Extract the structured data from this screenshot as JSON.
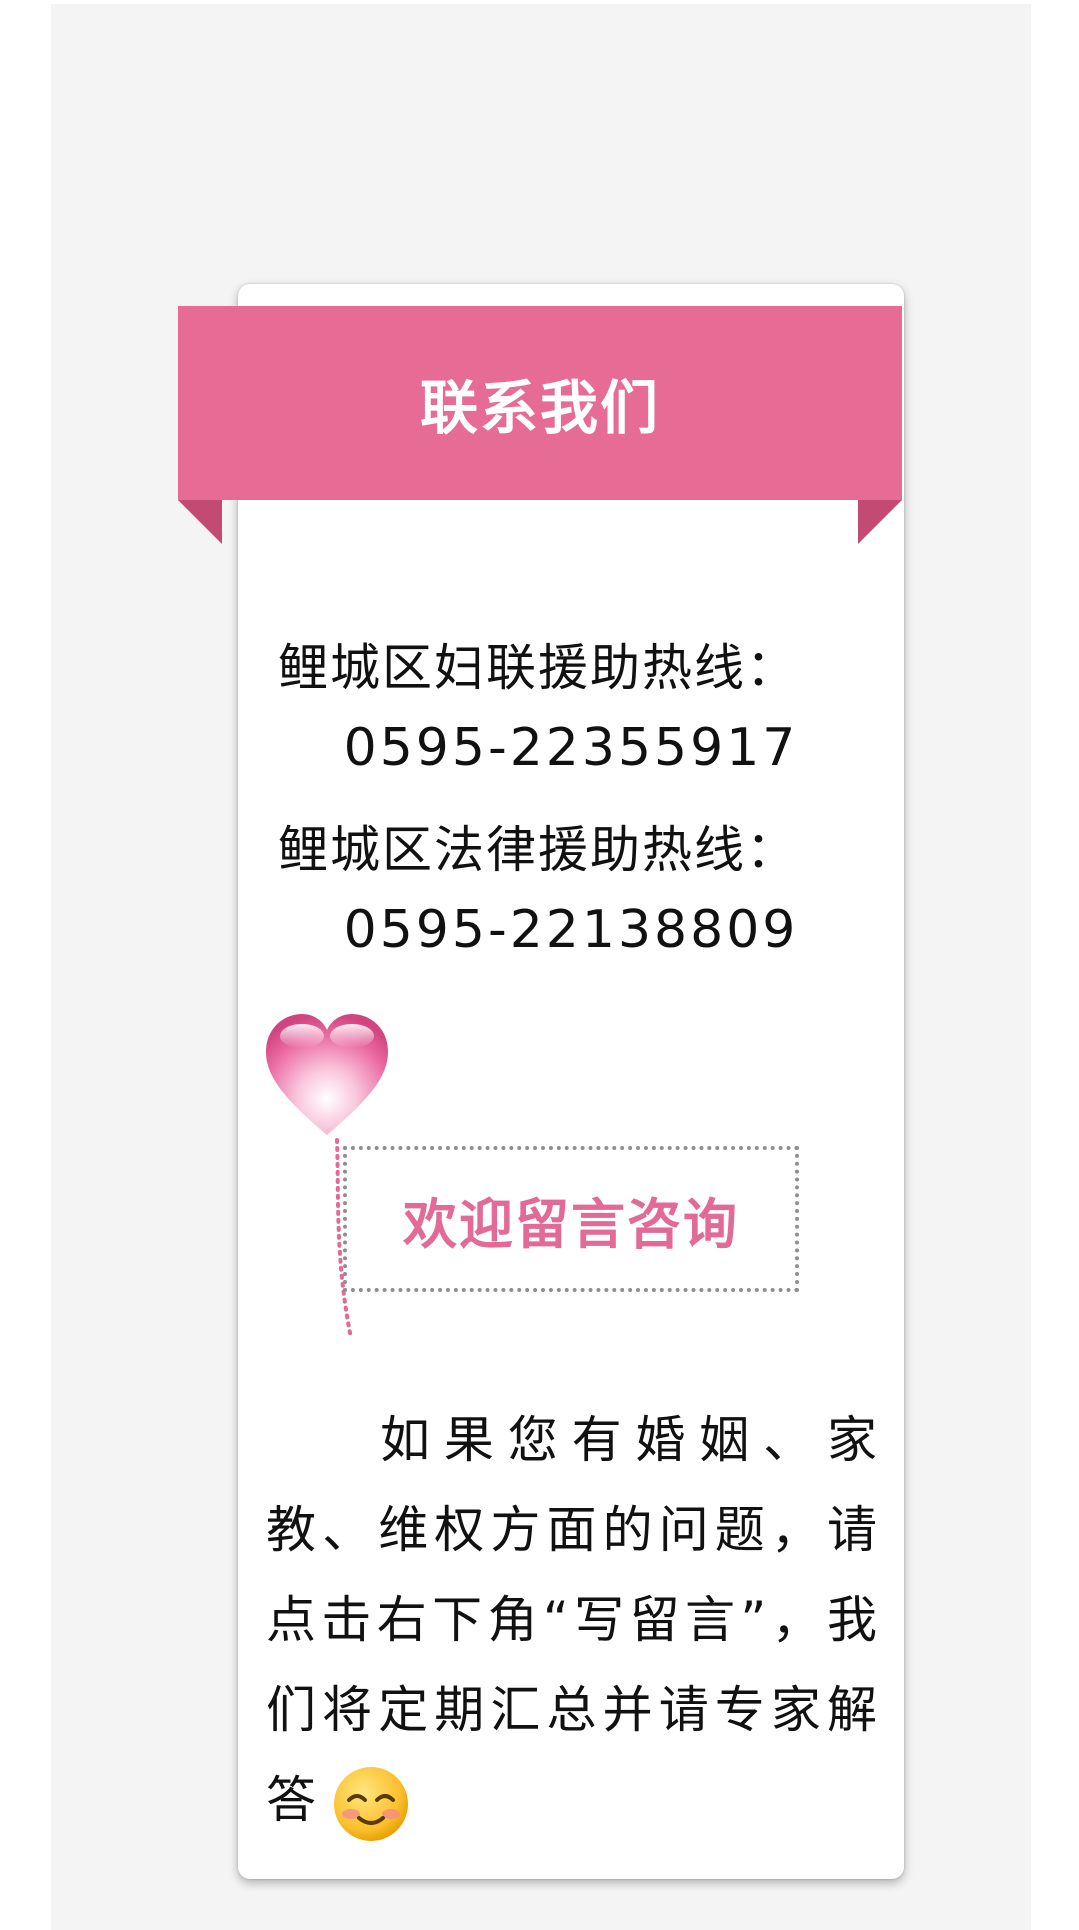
{
  "header": {
    "title": "联系我们"
  },
  "contacts": [
    {
      "label": "鲤城区妇联援助热线：",
      "number": "0595-22355917"
    },
    {
      "label": "鲤城区法律援助热线：",
      "number": "0595-22138809"
    }
  ],
  "consult": {
    "label": "欢迎留言咨询",
    "icon": "heart-balloon-icon"
  },
  "message": {
    "text": "如果您有婚姻、家教、维权方面的问题，请点击右下角“写留言”，我们将定期汇总并请专家解答",
    "emoji": "smiling-face-icon"
  },
  "colors": {
    "accent": "#e76c95",
    "accent_dark": "#c24a73",
    "consult_text": "#e26a97",
    "background": "#f4f4f4"
  }
}
